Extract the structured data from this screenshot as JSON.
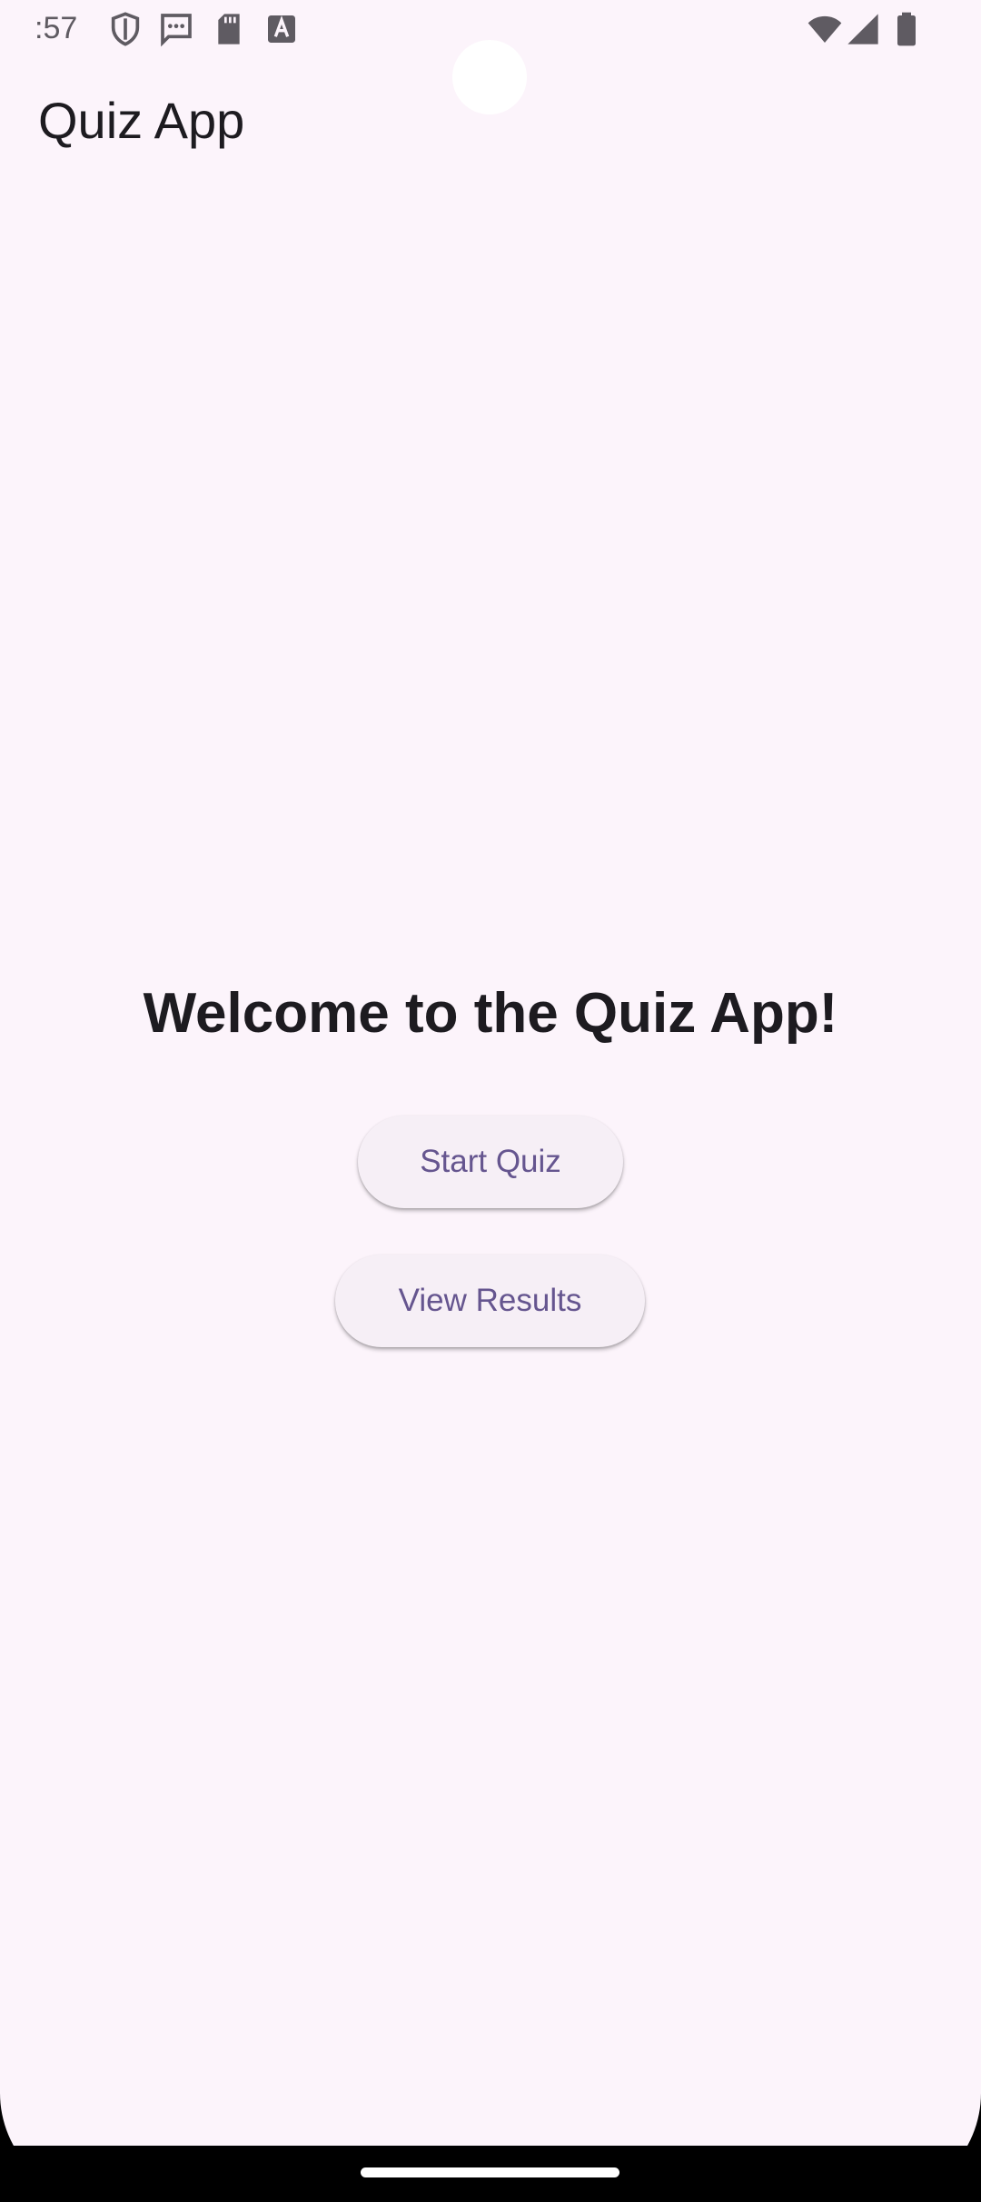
{
  "status_bar": {
    "time": ":57",
    "icons": {
      "left": [
        "shield-icon",
        "message-icon",
        "sd-card-icon",
        "keyboard-a-icon"
      ],
      "right": [
        "wifi-icon",
        "signal-icon",
        "battery-icon"
      ]
    }
  },
  "app_bar": {
    "title": "Quiz App"
  },
  "main": {
    "welcome_text": "Welcome to the Quiz App!",
    "start_button_label": "Start Quiz",
    "results_button_label": "View Results"
  },
  "colors": {
    "background": "#fcf4fb",
    "button_bg": "#f6eff6",
    "button_text": "#65558f",
    "text_primary": "#1d1b20"
  }
}
